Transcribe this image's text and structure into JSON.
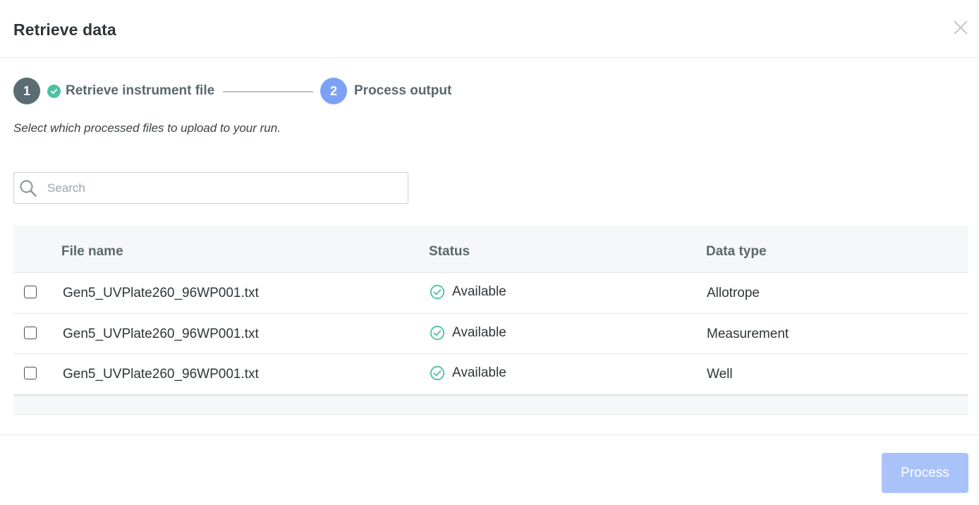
{
  "dialog": {
    "title": "Retrieve data",
    "close_icon": "close-icon"
  },
  "stepper": {
    "steps": [
      {
        "number": "1",
        "label": "Retrieve instrument file",
        "state": "complete",
        "color": "#5b6b72"
      },
      {
        "number": "2",
        "label": "Process output",
        "state": "active",
        "color": "#7da2f5"
      }
    ],
    "check_color": "#4fc0a3"
  },
  "instructions": "Select which processed files to upload to your run.",
  "search": {
    "placeholder": "Search",
    "value": ""
  },
  "table": {
    "columns": [
      "File name",
      "Status",
      "Data type"
    ],
    "rows": [
      {
        "file_name": "Gen5_UVPlate260_96WP001.txt",
        "status": "Available",
        "data_type": "Allotrope",
        "checked": false
      },
      {
        "file_name": "Gen5_UVPlate260_96WP001.txt",
        "status": "Available",
        "data_type": "Measurement",
        "checked": false
      },
      {
        "file_name": "Gen5_UVPlate260_96WP001.txt",
        "status": "Available",
        "data_type": "Well",
        "checked": false
      }
    ],
    "status_color": "#4fc0a3"
  },
  "footer": {
    "process_label": "Process",
    "process_disabled": true,
    "accent": "#a9c3fa"
  }
}
